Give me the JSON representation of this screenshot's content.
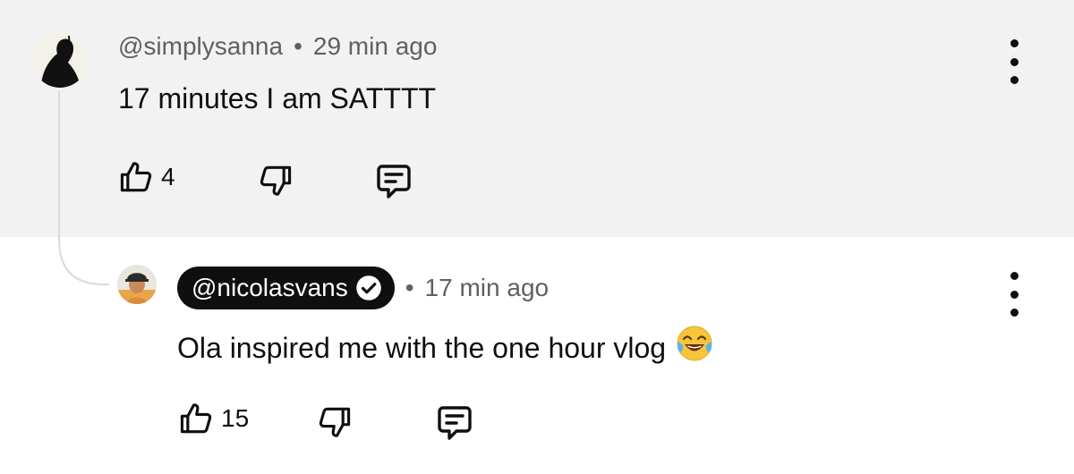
{
  "comments": [
    {
      "handle": "@simplysanna",
      "separator": "•",
      "time": "29 min ago",
      "text": "17 minutes I am SATTTT",
      "likes": "4",
      "avatar_icon": "avatar-silhouette"
    },
    {
      "handle": "@nicolasvans",
      "separator": "•",
      "time": "17 min ago",
      "text": "Ola inspired me with the one hour vlog",
      "emoji": "face-with-tears-of-joy",
      "likes": "15",
      "verified": true,
      "avatar_icon": "avatar-photo"
    }
  ],
  "colors": {
    "parent_background": "#f2f2f2",
    "reply_background": "#ffffff",
    "muted_text": "#606060",
    "badge_background": "#0f0f0f"
  }
}
